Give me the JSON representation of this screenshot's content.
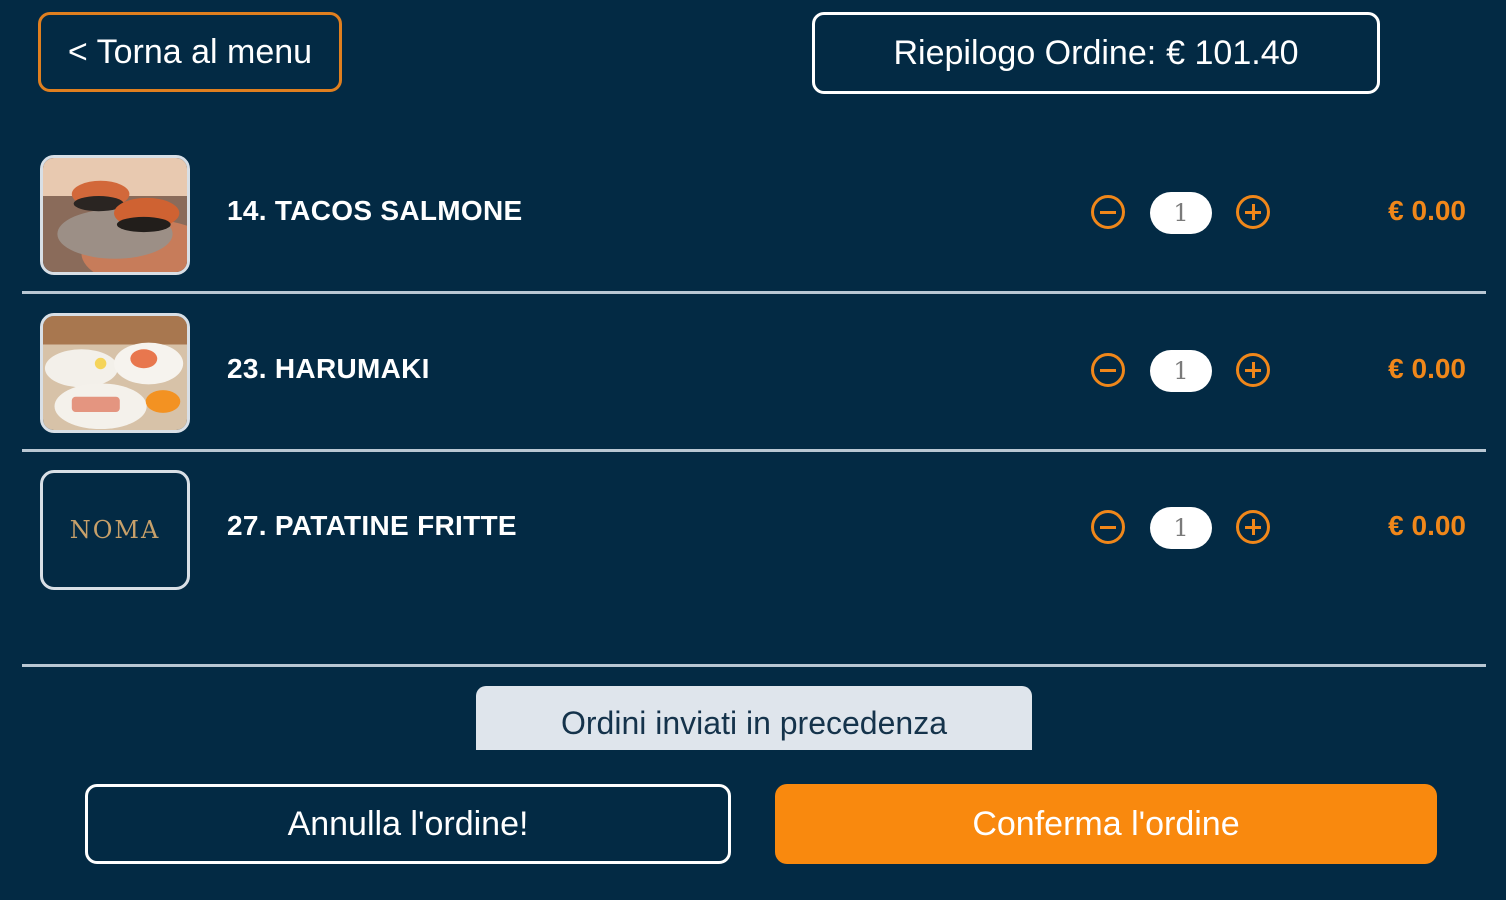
{
  "header": {
    "back_label": "< Torna al menu",
    "summary_label": "Riepilogo Ordine:",
    "summary_total": "€ 101.40"
  },
  "items": [
    {
      "name": "14. TACOS SALMONE",
      "quantity": "1",
      "price": "€ 0.00",
      "image": "salmon-sushi-photo"
    },
    {
      "name": "23. HARUMAKI",
      "quantity": "1",
      "price": "€ 0.00",
      "image": "sushi-platter-photo"
    },
    {
      "name": "27. PATATINE FRITTE",
      "quantity": "1",
      "price": "€ 0.00",
      "image": "noma-logo",
      "logo_text": "NOMA"
    }
  ],
  "footer": {
    "previous_orders_label": "Ordini inviati in precedenza",
    "cancel_label": "Annulla l'ordine!",
    "confirm_label": "Conferma l'ordine"
  },
  "colors": {
    "background": "#032a44",
    "accent": "#f9890e",
    "divider": "#b9c7d3"
  }
}
